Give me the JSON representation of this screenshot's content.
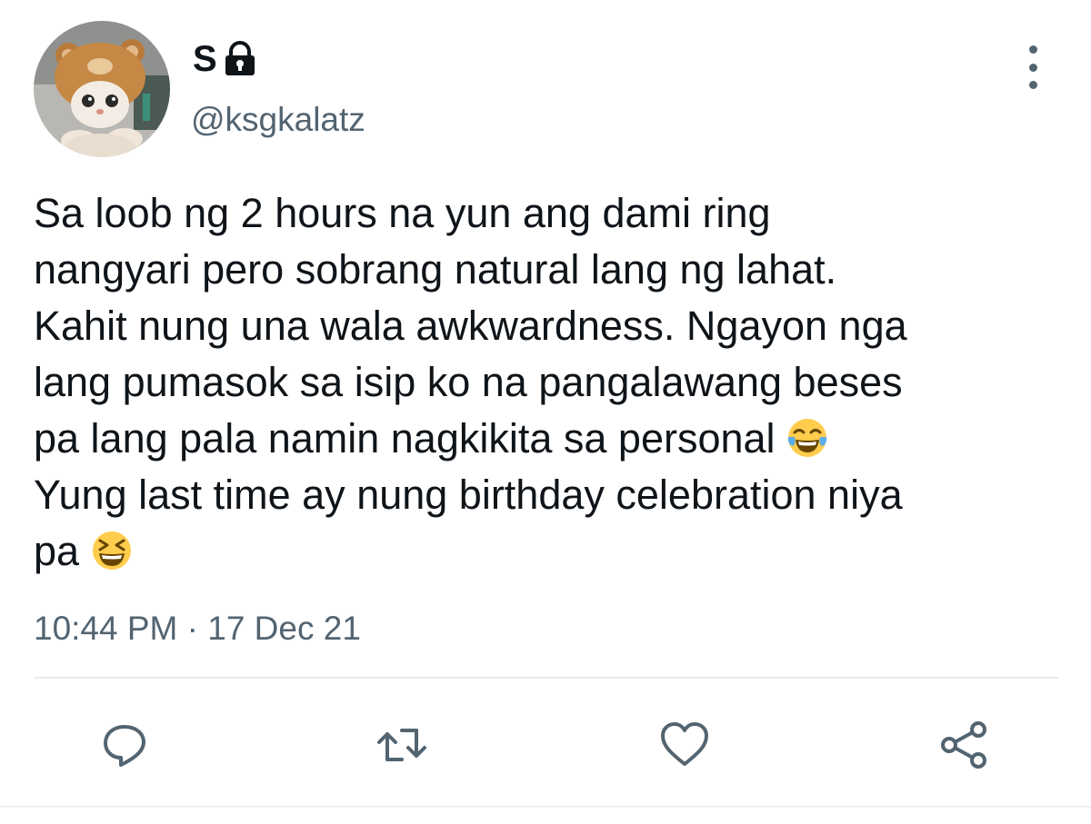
{
  "tweet": {
    "display_name": "S",
    "handle": "@ksgkalatz",
    "text_lines": [
      "Sa loob ng 2 hours na yun ang dami ring",
      "nangyari pero sobrang natural lang ng lahat.",
      "Kahit nung una wala awkwardness. Ngayon nga",
      "lang pumasok sa isip ko na pangalawang beses",
      "pa lang pala namin nagkikita sa personal",
      "Yung last time ay nung birthday celebration niya",
      "pa"
    ],
    "emojis": [
      "face-with-tears-of-joy",
      "grinning-squinting-face"
    ],
    "timestamp": "10:44 PM · 17 Dec 21",
    "protected_account": true
  },
  "icons": {
    "lock": "lock-icon",
    "more": "more-vertical-icon",
    "reply": "reply-icon",
    "retweet": "retweet-icon",
    "like": "heart-icon",
    "share": "share-icon"
  },
  "colors": {
    "text_primary": "#0f1419",
    "text_secondary": "#536471",
    "divider": "#e6ecf0",
    "emoji_yellow": "#ffcc4d"
  }
}
